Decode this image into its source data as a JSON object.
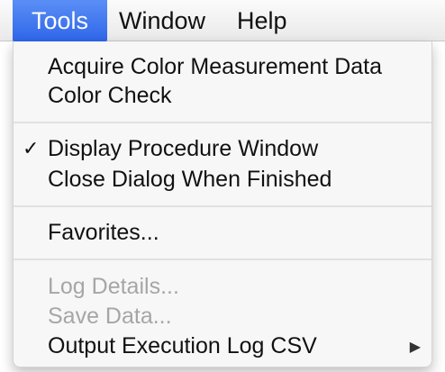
{
  "menubar": {
    "tools_label": "Tools",
    "window_label": "Window",
    "help_label": "Help"
  },
  "dropdown": {
    "items": [
      {
        "label": "Acquire Color Measurement Data",
        "enabled": true
      },
      {
        "label": "Color Check",
        "enabled": true
      },
      {
        "label": "Display Procedure Window",
        "enabled": true,
        "checked": true,
        "check_glyph": "✓"
      },
      {
        "label": "Close Dialog When Finished",
        "enabled": true
      },
      {
        "label": "Favorites...",
        "enabled": true
      },
      {
        "label": "Log Details...",
        "enabled": false
      },
      {
        "label": "Save Data...",
        "enabled": false
      },
      {
        "label": "Output Execution Log CSV",
        "enabled": true,
        "submenu": true,
        "arrow_glyph": "▶"
      }
    ]
  },
  "colors": {
    "highlight": "#3b74ef",
    "disabled_text": "#a6a6a6",
    "menu_background": "#f7f7f7"
  },
  "icons": {
    "checkmark": "check-icon",
    "submenu": "submenu-arrow-icon"
  }
}
